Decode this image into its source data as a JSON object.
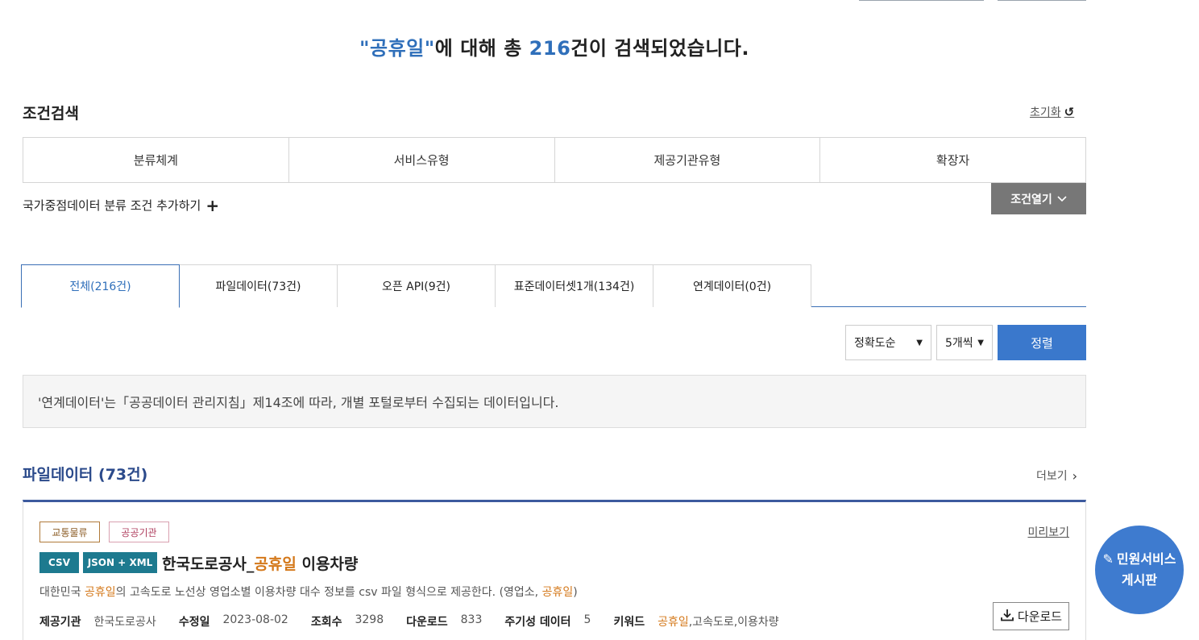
{
  "header": {
    "query_open": "\"",
    "query_term": "공휴일",
    "query_close": "\"",
    "text_middle": "에 대해 총 ",
    "count": "216",
    "text_end": "건이 검색되었습니다."
  },
  "condition": {
    "label": "조건검색",
    "reset_label": "초기화",
    "columns": [
      "분류체계",
      "서비스유형",
      "제공기관유형",
      "확장자"
    ],
    "add_label": "국가중점데이터 분류 조건 추가하기",
    "open_label": "조건열기"
  },
  "tabs": [
    "전체(216건)",
    "파일데이터(73건)",
    "오픈 API(9건)",
    "표준데이터셋1개(134건)",
    "연계데이터(0건)"
  ],
  "sort": {
    "order_value": "정확도순",
    "per_page_value": "5개씩",
    "button_label": "정렬"
  },
  "notice": "'연계데이터'는「공공데이터 관리지침」제14조에 따라, 개별 포털로부터 수집되는 데이터입니다.",
  "section": {
    "title": "파일데이터 (73건)",
    "more_label": "더보기"
  },
  "card": {
    "tag_category": "교통물류",
    "tag_org": "공공기관",
    "preview_label": "미리보기",
    "format_csv": "CSV",
    "format_json": "JSON + XML",
    "title_prefix": "한국도로공사_",
    "title_keyword": "공휴일",
    "title_suffix": " 이용차량",
    "desc_prefix": "대한민국 ",
    "desc_keyword": "공휴일",
    "desc_middle": "의 고속도로 노선상 영업소별 이용차량 대수 정보를 csv 파일 형식으로 제공한다. (영업소, ",
    "desc_keyword2": "공휴일",
    "desc_end": ")",
    "meta": {
      "provider_k": "제공기관",
      "provider_v": "한국도로공사",
      "modified_k": "수정일",
      "modified_v": "2023-08-02",
      "views_k": "조회수",
      "views_v": "3298",
      "downloads_k": "다운로드",
      "downloads_v": "833",
      "period_k": "주기성 데이터",
      "period_v": "5",
      "keyword_k": "키워드",
      "keyword_hl": "공휴일",
      "keyword_rest": ",고속도로,이용차량"
    },
    "download_label": "다운로드"
  },
  "fab": {
    "line1": "민원서비스",
    "line2": "게시판"
  }
}
